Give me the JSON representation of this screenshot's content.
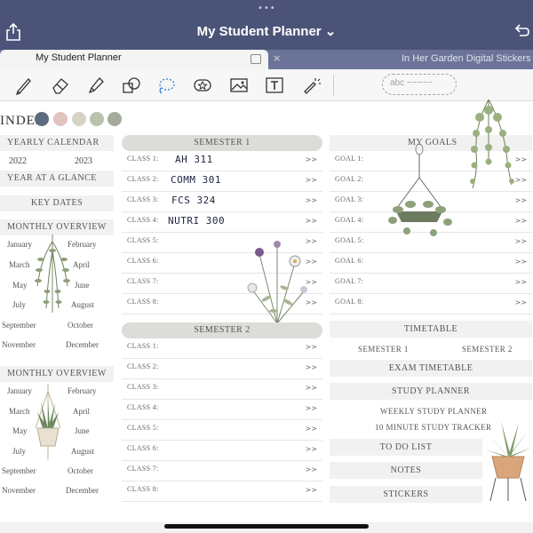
{
  "window": {
    "title": "My Student Planner ⌄",
    "more_dots": "•••",
    "share_icon": "share-icon",
    "undo_icon": "undo-icon"
  },
  "tabs": [
    {
      "label": "My Student Planner",
      "active": true
    },
    {
      "label": "In Her Garden Digital Stickers",
      "active": false
    }
  ],
  "tab_close": "×",
  "toolbar": {
    "tools": [
      "pen-icon",
      "eraser-icon",
      "highlighter-icon",
      "shapes-icon",
      "lasso-icon",
      "sticker-icon",
      "image-icon",
      "text-icon",
      "laser-pointer-icon"
    ],
    "text_style_placeholder": "abc ~~~~~"
  },
  "colors": {
    "swatches": [
      "#5d6b80",
      "#e2c3c0",
      "#d6d3c6",
      "#b9c2ac",
      "#a4ab9a"
    ]
  },
  "index": {
    "title": "INDEX",
    "yearly_calendar": "YEARLY CALENDAR",
    "year_a": "2022",
    "year_b": "2023",
    "year_at_a_glance": "YEAR AT A GLANCE",
    "key_dates": "KEY DATES",
    "monthly_overview_1": "MONTHLY OVERVIEW",
    "monthly_overview_2": "MONTHLY OVERVIEW",
    "months": [
      "January",
      "February",
      "March",
      "April",
      "May",
      "June",
      "July",
      "August",
      "September",
      "October",
      "November",
      "December"
    ]
  },
  "semester1": {
    "title": "SEMESTER 1",
    "rows": [
      {
        "label": "CLASS 1:",
        "value": "AH 311",
        "arrow": ">>"
      },
      {
        "label": "CLASS 2:",
        "value": "COMM 301",
        "arrow": ">>"
      },
      {
        "label": "CLASS 3:",
        "value": "FCS 324",
        "arrow": ">>"
      },
      {
        "label": "CLASS 4:",
        "value": "NUTRI 300",
        "arrow": ">>"
      },
      {
        "label": "CLASS 5:",
        "value": "",
        "arrow": ">>"
      },
      {
        "label": "CLASS 6:",
        "value": "",
        "arrow": ">>"
      },
      {
        "label": "CLASS 7:",
        "value": "",
        "arrow": ">>"
      },
      {
        "label": "CLASS 8:",
        "value": "",
        "arrow": ">>"
      }
    ]
  },
  "semester2": {
    "title": "SEMESTER 2",
    "rows": [
      {
        "label": "CLASS 1:",
        "arrow": ">>"
      },
      {
        "label": "CLASS 2:",
        "arrow": ">>"
      },
      {
        "label": "CLASS 3:",
        "arrow": ">>"
      },
      {
        "label": "CLASS 4:",
        "arrow": ">>"
      },
      {
        "label": "CLASS 5:",
        "arrow": ">>"
      },
      {
        "label": "CLASS 6:",
        "arrow": ">>"
      },
      {
        "label": "CLASS 7:",
        "arrow": ">>"
      },
      {
        "label": "CLASS 8:",
        "arrow": ">>"
      }
    ]
  },
  "goals": {
    "title": "MY GOALS",
    "rows": [
      {
        "label": "GOAL 1:",
        "arrow": ">>"
      },
      {
        "label": "GOAL 2:",
        "arrow": ">>"
      },
      {
        "label": "GOAL 3:",
        "arrow": ">>"
      },
      {
        "label": "GOAL 4:",
        "arrow": ">>"
      },
      {
        "label": "GOAL 5:",
        "arrow": ">>"
      },
      {
        "label": "GOAL 6:",
        "arrow": ">>"
      },
      {
        "label": "GOAL 7:",
        "arrow": ">>"
      },
      {
        "label": "GOAL 8:",
        "arrow": ">>"
      }
    ]
  },
  "right_links": {
    "timetable": "TIMETABLE",
    "semester_1": "SEMESTER 1",
    "semester_2": "SEMESTER 2",
    "exam_timetable": "EXAM TIMETABLE",
    "study_planner": "STUDY PLANNER",
    "weekly_study_planner": "WEEKLY STUDY PLANNER",
    "ten_minute_tracker": "10 MINUTE STUDY TRACKER",
    "to_do_list": "TO DO LIST",
    "notes": "NOTES",
    "stickers": "STICKERS"
  }
}
